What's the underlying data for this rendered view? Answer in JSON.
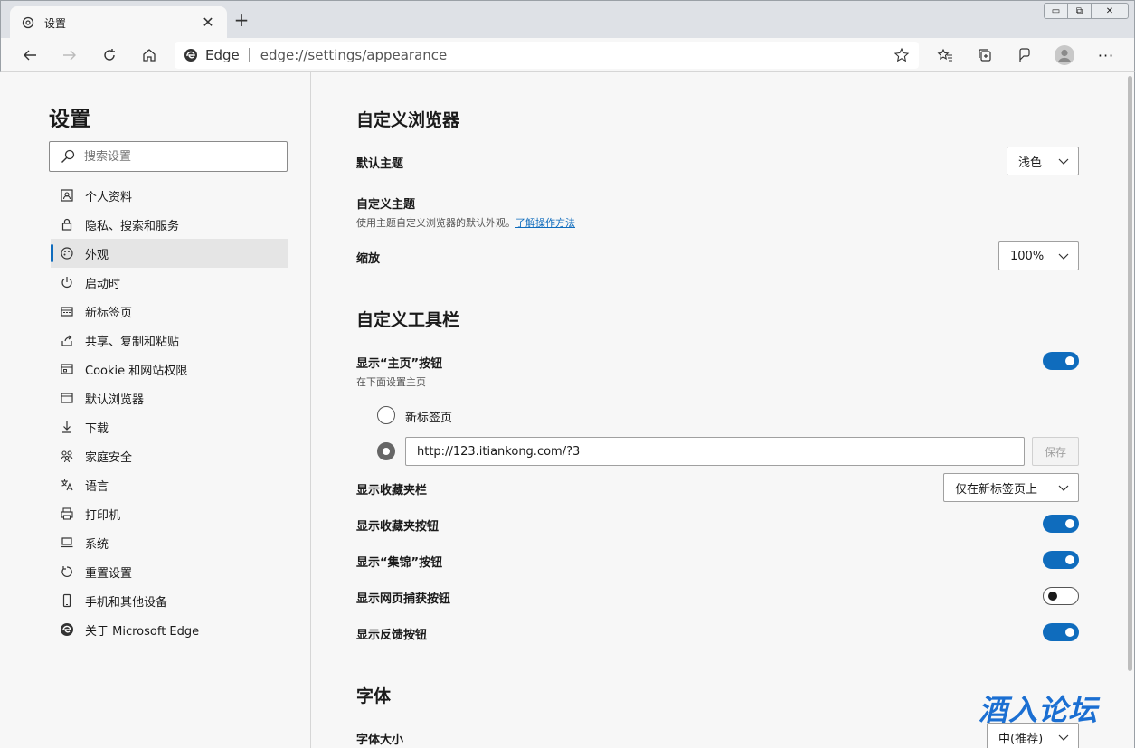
{
  "tab": {
    "title": "设置",
    "close": "✕",
    "new": "+"
  },
  "window": {
    "minimize": "▭",
    "restore": "⧉",
    "close": "✕"
  },
  "address": {
    "site": "Edge",
    "url": "edge://settings/appearance"
  },
  "toolbar": {
    "more": "···"
  },
  "nav": {
    "title": "设置",
    "search_placeholder": "搜索设置",
    "items": [
      {
        "label": "个人资料",
        "icon": "profile-icon"
      },
      {
        "label": "隐私、搜索和服务",
        "icon": "lock-icon"
      },
      {
        "label": "外观",
        "icon": "palette-icon",
        "active": true
      },
      {
        "label": "启动时",
        "icon": "power-icon"
      },
      {
        "label": "新标签页",
        "icon": "newtab-icon"
      },
      {
        "label": "共享、复制和粘贴",
        "icon": "share-icon"
      },
      {
        "label": "Cookie 和网站权限",
        "icon": "site-permissions-icon"
      },
      {
        "label": "默认浏览器",
        "icon": "browser-icon"
      },
      {
        "label": "下载",
        "icon": "download-icon"
      },
      {
        "label": "家庭安全",
        "icon": "family-icon"
      },
      {
        "label": "语言",
        "icon": "language-icon"
      },
      {
        "label": "打印机",
        "icon": "printer-icon"
      },
      {
        "label": "系统",
        "icon": "system-icon"
      },
      {
        "label": "重置设置",
        "icon": "reset-icon"
      },
      {
        "label": "手机和其他设备",
        "icon": "phone-icon"
      },
      {
        "label": "关于 Microsoft Edge",
        "icon": "edge-icon"
      }
    ]
  },
  "main": {
    "customize_browser": {
      "title": "自定义浏览器",
      "default_theme_label": "默认主题",
      "default_theme_value": "浅色",
      "custom_theme_label": "自定义主题",
      "custom_theme_desc": "使用主题自定义浏览器的默认外观。",
      "custom_theme_link": "了解操作方法",
      "zoom_label": "缩放",
      "zoom_value": "100%"
    },
    "customize_toolbar": {
      "title": "自定义工具栏",
      "home_label": "显示“主页”按钮",
      "home_desc": "在下面设置主页",
      "home_on": true,
      "radio_newtab": "新标签页",
      "home_url": "http://123.itiankong.com/?3",
      "save": "保存",
      "favbar_label": "显示收藏夹栏",
      "favbar_value": "仅在新标签页上",
      "fav_button_label": "显示收藏夹按钮",
      "fav_button_on": true,
      "collections_label": "显示“集锦”按钮",
      "collections_on": true,
      "capture_label": "显示网页捕获按钮",
      "capture_on": false,
      "feedback_label": "显示反馈按钮",
      "feedback_on": true
    },
    "fonts": {
      "title": "字体",
      "size_label": "字体大小",
      "size_value": "中(推荐)"
    }
  },
  "watermark": "酒入论坛",
  "colors": {
    "accent": "#0f6cbd",
    "watermark": "#1b6fd2"
  }
}
